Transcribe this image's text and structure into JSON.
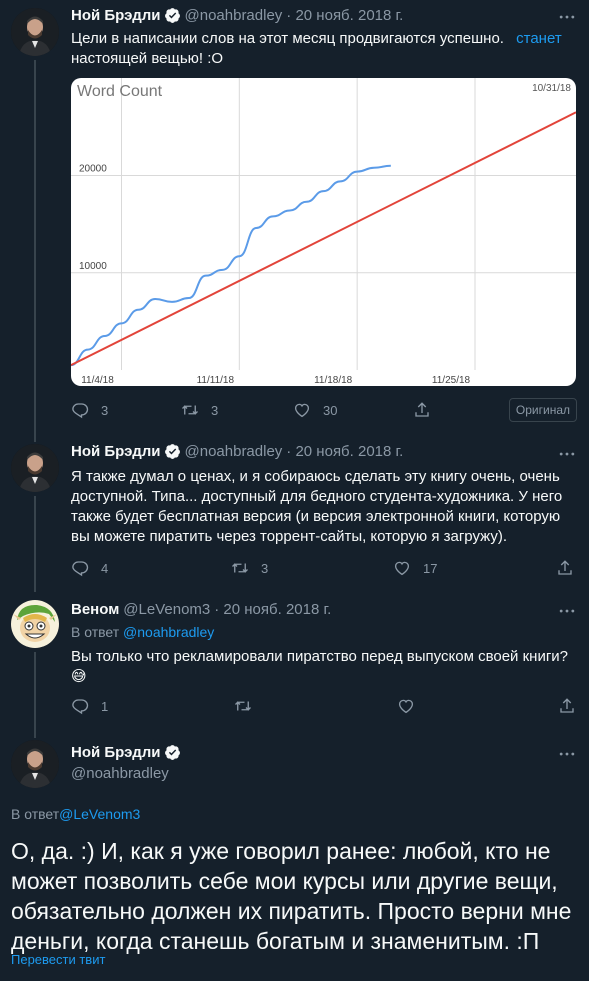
{
  "tweets": [
    {
      "author": "Ной Брэдли",
      "handle": "@noahbradley",
      "date": "· 20 нояб. 2018 г.",
      "text_before": "Цели в написании слов на этот месяц продвигаются успешно.",
      "text_link": "станет",
      "text_after": "настоящей вещью! :O",
      "replies": "3",
      "retweets": "3",
      "likes": "30",
      "original_label": "Оригинал"
    },
    {
      "author": "Ной Брэдли",
      "handle": "@noahbradley",
      "date": "· 20 нояб. 2018 г.",
      "text": "Я также думал о ценах, и я собираюсь сделать эту книгу очень, очень доступной. Типа... доступный для бедного студента-художника. У него также будет бесплатная версия (и версия электронной книги, которую вы можете пиратить через торрент-сайты, которую я загружу).",
      "replies": "4",
      "retweets": "3",
      "likes": "17"
    },
    {
      "author": "Веном",
      "handle": "@LeVenom3",
      "date": "· 20 нояб. 2018 г.",
      "reply_to_label": "В ответ",
      "reply_to_handle": "@noahbradley",
      "text": "Вы только что рекламировали пиратство перед выпуском своей книги?",
      "emoji": "😅",
      "replies": "1"
    },
    {
      "author": "Ной Брэдли",
      "handle": "@noahbradley",
      "reply_to_label": "В ответ",
      "reply_to_handle": "@LeVenom3",
      "text": "О, да. :) И, как я уже говорил ранее: любой, кто не может позволить себе мои курсы или другие вещи, обязательно должен их пиратить. Просто верни мне деньги, когда станешь богатым и знаменитым. :П",
      "translate_label": "Перевести твит"
    }
  ],
  "colors": {
    "background": "#15202b",
    "text": "#f7f9f9",
    "muted": "#8b98a5",
    "accent": "#1d9bf0",
    "chart_actual": "#5b9be8",
    "chart_target": "#e2443a"
  },
  "chart_data": {
    "type": "line",
    "title": "Word Count",
    "corner_label": "10/31/18",
    "x_tick_labels": [
      "11/4/18",
      "11/11/18",
      "11/18/18",
      "11/25/18"
    ],
    "y_tick_labels": [
      "10000",
      "20000"
    ],
    "xlim": [
      1,
      31
    ],
    "ylim": [
      0,
      29000
    ],
    "grid": true,
    "series": [
      {
        "role": "actual",
        "x": [
          1,
          2,
          3,
          4,
          5,
          6,
          7,
          8,
          9,
          10,
          11,
          12,
          13,
          14,
          15,
          16,
          17,
          18,
          19,
          20
        ],
        "values": [
          500,
          2100,
          3500,
          4800,
          6200,
          7300,
          7000,
          7400,
          9700,
          10300,
          11700,
          14600,
          15800,
          16400,
          17300,
          18400,
          19400,
          20400,
          20800,
          21000
        ]
      },
      {
        "role": "target",
        "x": [
          1,
          31
        ],
        "values": [
          500,
          26500
        ]
      }
    ]
  }
}
